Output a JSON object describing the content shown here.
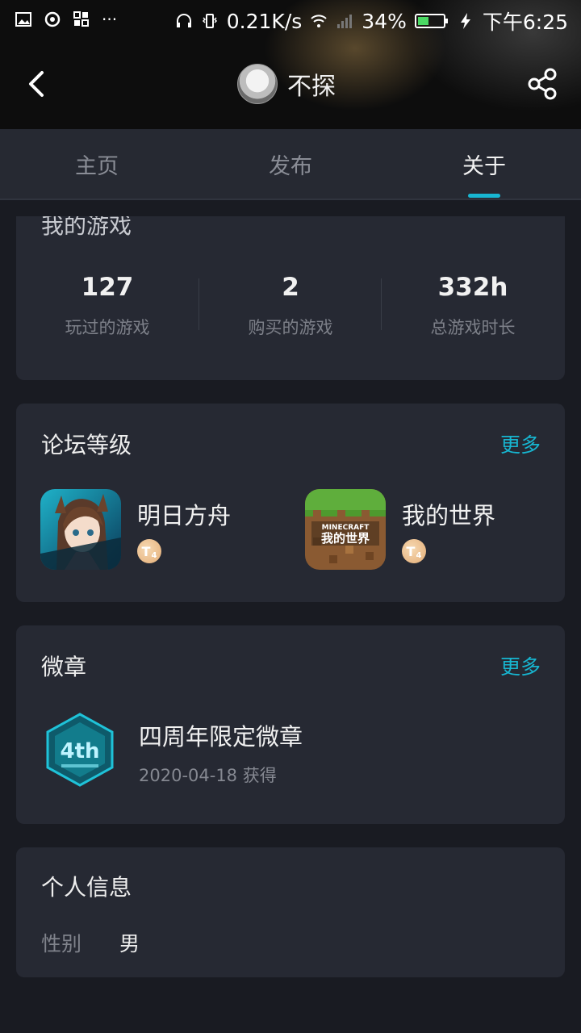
{
  "status_bar": {
    "network_speed": "0.21K/s",
    "battery": "34%",
    "time": "下午6:25",
    "more_dots": "···"
  },
  "header": {
    "username": "不探",
    "avatar_icon": "avatar-icon",
    "back_icon": "back-arrow-icon",
    "share_icon": "share-icon"
  },
  "tabs": [
    {
      "label": "主页",
      "active": false
    },
    {
      "label": "发布",
      "active": false
    },
    {
      "label": "关于",
      "active": true
    }
  ],
  "my_games": {
    "title": "我的游戏",
    "stats": [
      {
        "value": "127",
        "label": "玩过的游戏"
      },
      {
        "value": "2",
        "label": "购买的游戏"
      },
      {
        "value": "332h",
        "label": "总游戏时长"
      }
    ]
  },
  "forum_level": {
    "title": "论坛等级",
    "more": "更多",
    "items": [
      {
        "name": "明日方舟",
        "level": "T",
        "level_num": "4",
        "icon": "arknights-icon"
      },
      {
        "name": "我的世界",
        "level": "T",
        "level_num": "4",
        "icon": "minecraft-icon"
      }
    ]
  },
  "badges": {
    "title": "微章",
    "more": "更多",
    "items": [
      {
        "name": "四周年限定微章",
        "date": "2020-04-18 获得",
        "badge_text": "4th",
        "icon": "anniversary-badge-icon"
      }
    ]
  },
  "personal_info": {
    "title": "个人信息",
    "fields": [
      {
        "label": "性别",
        "value": "男"
      }
    ]
  },
  "colors": {
    "accent": "#17b5d0",
    "background": "#191b22",
    "card": "#262933"
  }
}
